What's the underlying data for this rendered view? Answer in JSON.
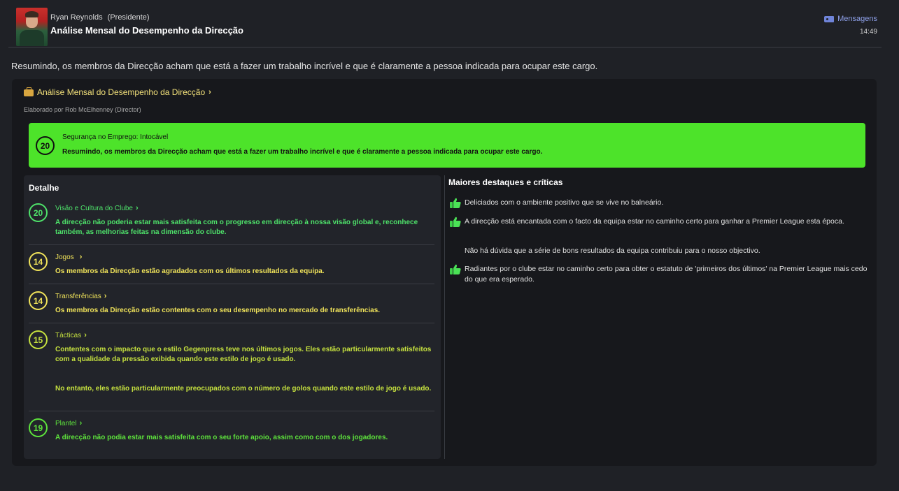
{
  "header": {
    "sender_name": "Ryan Reynolds",
    "sender_role": "(Presidente)",
    "subject": "Análise Mensal do Desempenho da Direcção",
    "messages_link": "Mensagens",
    "time": "14:49"
  },
  "summary": "Resumindo, os membros da Direcção acham que está a fazer um trabalho incrível e que é claramente a pessoa indicada para ocupar este cargo.",
  "card": {
    "title": "Análise Mensal do Desempenho da Direcção",
    "author": "Elaborado por Rob McElhenney (Director)"
  },
  "banner": {
    "score": "20",
    "label": "Segurança no Emprego: Intocável",
    "text": "Resumindo, os membros da Direcção acham que está a fazer um trabalho incrível e que é claramente a pessoa indicada para ocupar este cargo."
  },
  "detail": {
    "title": "Detalhe",
    "rows": [
      {
        "score": "20",
        "title": "Visão e Cultura do Clube",
        "text": "A direcção não poderia estar mais satisfeita com o progresso em direcção à nossa visão global e, reconhece também, as melhorias feitas na dimensão do clube."
      },
      {
        "score": "14",
        "title": "Jogos",
        "text": "Os membros da Direcção estão agradados com os últimos resultados da equipa."
      },
      {
        "score": "14",
        "title": "Transferências",
        "text": "Os membros da Direcção estão contentes com o seu desempenho no mercado de transferências."
      },
      {
        "score": "15",
        "title": "Tácticas",
        "text": "Contentes com o impacto que o estilo Gegenpress teve nos últimos jogos. Eles estão particularmente satisfeitos com a qualidade da pressão exibida quando este estilo de jogo é usado.",
        "text2": "No entanto, eles estão particularmente preocupados com o número de golos quando este estilo de jogo é usado."
      },
      {
        "score": "19",
        "title": "Plantel",
        "text": "A direcção não podia estar mais satisfeita com o seu forte apoio, assim como com o dos jogadores."
      }
    ]
  },
  "highlights": {
    "title": "Maiores destaques e críticas",
    "items": [
      "Deliciados com o ambiente positivo que se vive no balneário.",
      "A direcção está encantada com o facto da equipa estar no caminho certo para ganhar a Premier League esta época.",
      "Não há dúvida que a série de bons resultados da equipa contribuiu para o nosso objectivo.",
      "Radiantes por o clube estar no caminho certo para obter o estatuto de 'primeiros dos últimos' na Premier League mais cedo do que era esperado."
    ]
  },
  "icons": [
    "avatar-photo",
    "tag-icon",
    "briefcase-icon",
    "chevron-right-icon",
    "thumbs-up-icon"
  ]
}
